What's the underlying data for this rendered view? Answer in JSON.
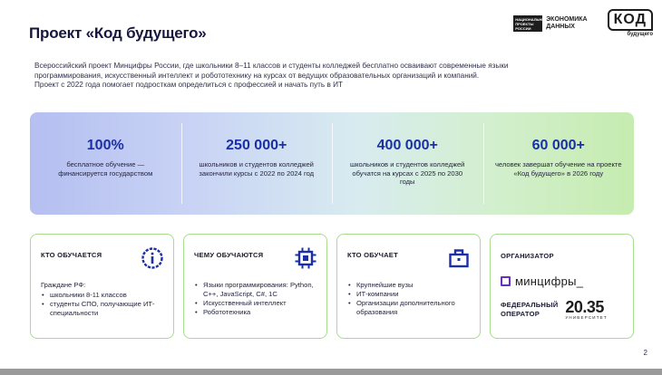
{
  "title": "Проект «Код будущего»",
  "logos": {
    "ministry_badge": "НАЦИОНАЛЬНЫЕ ПРОЕКТЫ РОССИИ",
    "economy_line1": "ЭКОНОМИКА",
    "economy_line2": "ДАННЫХ",
    "kod_word": "КОД",
    "kod_sub": "будущего"
  },
  "intro": {
    "line1": "Всероссийский проект Минцифры России, где школьники 8–11 классов и студенты колледжей бесплатно осваивают современные языки",
    "line2": "программирования, искусственный интеллект и робототехнику на курсах от ведущих образовательных организаций и компаний.",
    "line3": "Проект с 2022 года помогает подросткам определиться с профессией и начать путь в ИТ"
  },
  "stats": [
    {
      "value": "100%",
      "desc": "бесплатное обучение — финансируется государством"
    },
    {
      "value": "250 000+",
      "desc": "школьников и студентов колледжей закончили курсы с 2022 по 2024 год"
    },
    {
      "value": "400 000+",
      "desc": "школьников и студентов колледжей обучатся на курсах с 2025 по 2030 годы"
    },
    {
      "value": "60 000+",
      "desc": "человек завершат обучение на проекте «Код будущего» в 2026 году"
    }
  ],
  "cards": {
    "who_learns": {
      "title": "КТО ОБУЧАЕТСЯ",
      "icon": "info-icon",
      "lead": "Граждане РФ:",
      "items": [
        "школьники 8-11 классов",
        "студенты СПО, получающие ИТ-специальности"
      ]
    },
    "what_learn": {
      "title": "ЧЕМУ ОБУЧАЮТСЯ",
      "icon": "chip-icon",
      "items": [
        "Языки программирования: Python, C++, JavaScript, C#, 1C",
        "Искусственный интеллект",
        "Робототехника"
      ]
    },
    "who_teaches": {
      "title": "КТО ОБУЧАЕТ",
      "icon": "briefcase-icon",
      "items": [
        "Крупнейшие вузы",
        "ИТ-компании",
        "Организации дополнительного образования"
      ]
    },
    "organizer": {
      "title": "ОРГАНИЗАТОР",
      "ministry": "минцифры_",
      "operator_label_line1": "ФЕДЕРАЛЬНЫЙ",
      "operator_label_line2": "ОПЕРАТОР",
      "operator_name": "20.35",
      "operator_sub": "УНИВЕРСИТЕТ"
    }
  },
  "page_number": "2",
  "colors": {
    "accent_blue": "#1a2fa8",
    "card_border": "#a8dc8f",
    "ministry_purple": "#6b2fbf"
  }
}
